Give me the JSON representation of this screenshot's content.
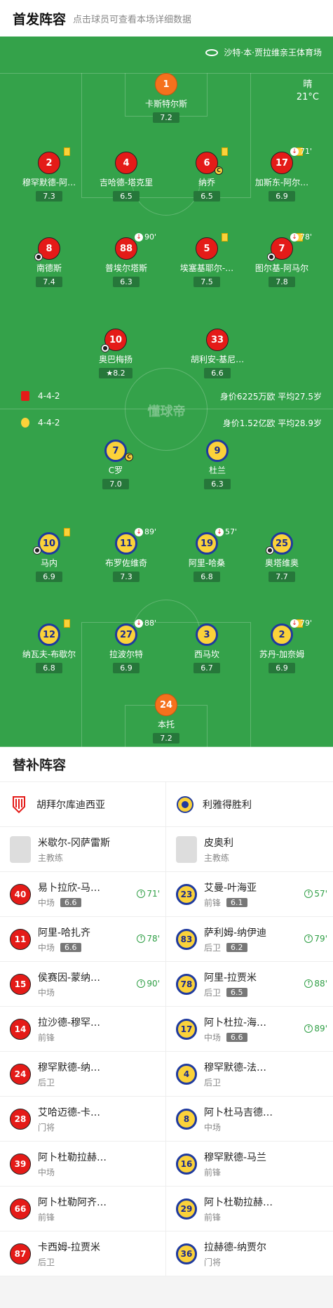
{
  "header": {
    "title": "首发阵容",
    "subtitle": "点击球员可查看本场详细数据"
  },
  "pitch": {
    "stadium": "沙特·本·贾拉维亲王体育场",
    "weather": {
      "condition": "晴",
      "temperature": "21°C"
    },
    "watermark": "懂球帝",
    "home": {
      "formation": "4-4-2",
      "summary": "身价6225万欧  平均27.5岁",
      "color": "#e41b18"
    },
    "away": {
      "formation": "4-4-2",
      "summary": "身价1.52亿欧  平均28.9岁",
      "color": "#fbd23a"
    }
  },
  "home_players": [
    {
      "num": "1",
      "name": "卡斯特尔斯",
      "rating": "7.2",
      "style": "org"
    },
    {
      "num": "2",
      "name": "穆罕默德-阿…",
      "rating": "7.3",
      "style": "red",
      "yellow": true
    },
    {
      "num": "4",
      "name": "吉哈德-塔克里",
      "rating": "6.5",
      "style": "red"
    },
    {
      "num": "6",
      "name": "纳乔",
      "rating": "6.5",
      "style": "red",
      "yellow": true,
      "captain": true
    },
    {
      "num": "17",
      "name": "加斯东-阿尔…",
      "rating": "6.9",
      "style": "red",
      "yellow": true,
      "sub": "71'"
    },
    {
      "num": "8",
      "name": "南德斯",
      "rating": "7.4",
      "style": "red",
      "ball": true
    },
    {
      "num": "88",
      "name": "普埃尔塔斯",
      "rating": "6.3",
      "style": "red",
      "sub": "90'"
    },
    {
      "num": "5",
      "name": "埃塞基耶尔-…",
      "rating": "7.5",
      "style": "red",
      "yellow": true
    },
    {
      "num": "7",
      "name": "图尔基-阿马尔",
      "rating": "7.8",
      "style": "red",
      "yellow": true,
      "sub": "78'",
      "ball": true
    },
    {
      "num": "10",
      "name": "奥巴梅扬",
      "rating": "8.2",
      "style": "red",
      "ball": true,
      "star": true
    },
    {
      "num": "33",
      "name": "胡利安-基尼…",
      "rating": "6.6",
      "style": "red"
    }
  ],
  "away_players": [
    {
      "num": "7",
      "name": "C罗",
      "rating": "7.0",
      "style": "yel",
      "captain": true
    },
    {
      "num": "9",
      "name": "杜兰",
      "rating": "6.3",
      "style": "yel"
    },
    {
      "num": "10",
      "name": "马内",
      "rating": "6.9",
      "style": "yel",
      "yellow": true,
      "ball": true
    },
    {
      "num": "11",
      "name": "布罗佐维奇",
      "rating": "7.3",
      "style": "yel",
      "sub": "89'"
    },
    {
      "num": "19",
      "name": "阿里-哈桑",
      "rating": "6.8",
      "style": "yel",
      "sub": "57'"
    },
    {
      "num": "25",
      "name": "奥塔维奥",
      "rating": "7.7",
      "style": "yel",
      "ball": true
    },
    {
      "num": "12",
      "name": "纳瓦夫-布歇尔",
      "rating": "6.8",
      "style": "yel",
      "yellow": true
    },
    {
      "num": "27",
      "name": "拉波尔特",
      "rating": "6.9",
      "style": "yel",
      "sub": "88'"
    },
    {
      "num": "3",
      "name": "西马坎",
      "rating": "6.7",
      "style": "yel"
    },
    {
      "num": "2",
      "name": "苏丹-加奈姆",
      "rating": "6.9",
      "style": "yel",
      "yellow": true,
      "sub": "79'"
    },
    {
      "num": "24",
      "name": "本托",
      "rating": "7.2",
      "style": "org"
    }
  ],
  "subs": {
    "title": "替补阵容",
    "home": {
      "team": "胡拜尔库迪西亚",
      "coach": {
        "name": "米歇尔-冈萨雷斯",
        "role": "主教练"
      },
      "players": [
        {
          "num": "40",
          "name": "易卜拉欣-马…",
          "pos": "中场",
          "rating": "6.6",
          "sub_in": "71'"
        },
        {
          "num": "11",
          "name": "阿里-哈扎齐",
          "pos": "中场",
          "rating": "6.6",
          "sub_in": "78'"
        },
        {
          "num": "15",
          "name": "侯赛因-蒙纳…",
          "pos": "中场",
          "sub_in": "90'"
        },
        {
          "num": "14",
          "name": "拉沙德-穆罕…",
          "pos": "前锋"
        },
        {
          "num": "24",
          "name": "穆罕默德-纳…",
          "pos": "后卫"
        },
        {
          "num": "28",
          "name": "艾哈迈德-卡…",
          "pos": "门将"
        },
        {
          "num": "39",
          "name": "阿卜杜勒拉赫…",
          "pos": "中场"
        },
        {
          "num": "66",
          "name": "阿卜杜勒阿齐…",
          "pos": "前锋"
        },
        {
          "num": "87",
          "name": "卡西姆-拉贾米",
          "pos": "后卫"
        }
      ]
    },
    "away": {
      "team": "利雅得胜利",
      "coach": {
        "name": "皮奥利",
        "role": "主教练"
      },
      "players": [
        {
          "num": "23",
          "name": "艾曼-叶海亚",
          "pos": "前锋",
          "rating": "6.1",
          "sub_in": "57'"
        },
        {
          "num": "83",
          "name": "萨利姆-纳伊迪",
          "pos": "后卫",
          "rating": "6.2",
          "sub_in": "79'"
        },
        {
          "num": "78",
          "name": "阿里-拉贾米",
          "pos": "后卫",
          "rating": "6.5",
          "sub_in": "88'"
        },
        {
          "num": "17",
          "name": "阿卜杜拉-海…",
          "pos": "中场",
          "rating": "6.6",
          "sub_in": "89'"
        },
        {
          "num": "4",
          "name": "穆罕默德-法…",
          "pos": "后卫"
        },
        {
          "num": "8",
          "name": "阿卜杜马吉德…",
          "pos": "中场"
        },
        {
          "num": "16",
          "name": "穆罕默德-马兰",
          "pos": "前锋"
        },
        {
          "num": "29",
          "name": "阿卜杜勒拉赫…",
          "pos": "前锋"
        },
        {
          "num": "36",
          "name": "拉赫德-纳贾尔",
          "pos": "门将"
        }
      ]
    }
  }
}
